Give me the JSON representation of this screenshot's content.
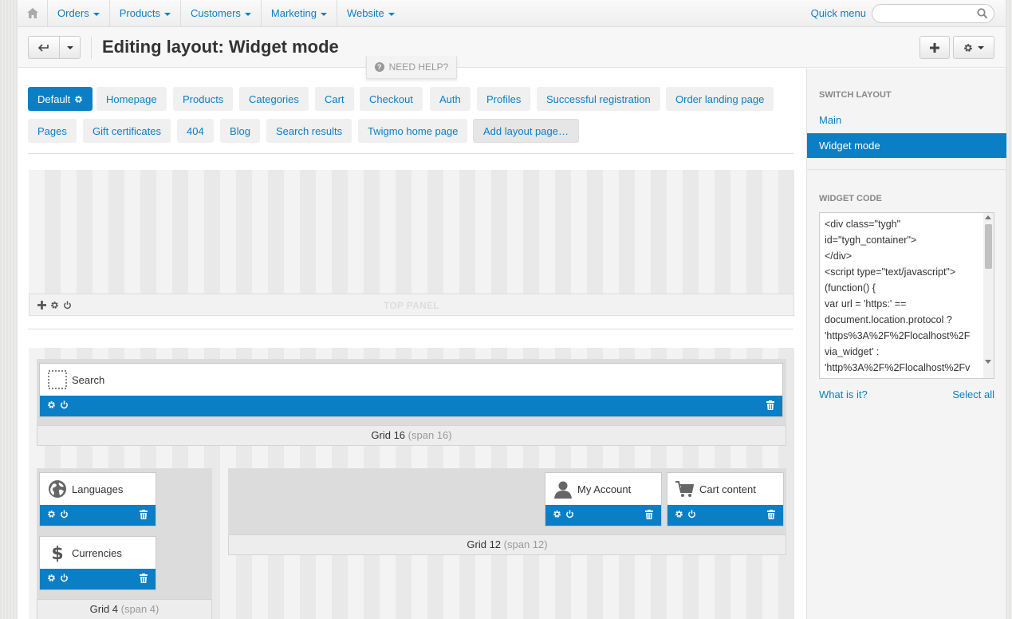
{
  "topnav": {
    "items": [
      {
        "label": "Orders"
      },
      {
        "label": "Products"
      },
      {
        "label": "Customers"
      },
      {
        "label": "Marketing"
      },
      {
        "label": "Website"
      }
    ],
    "quick_menu": "Quick menu",
    "search_placeholder": ""
  },
  "header": {
    "title": "Editing layout: Widget mode",
    "need_help": "NEED HELP?"
  },
  "tabs": [
    {
      "label": "Default"
    },
    {
      "label": "Homepage"
    },
    {
      "label": "Products"
    },
    {
      "label": "Categories"
    },
    {
      "label": "Cart"
    },
    {
      "label": "Checkout"
    },
    {
      "label": "Auth"
    },
    {
      "label": "Profiles"
    },
    {
      "label": "Successful registration"
    },
    {
      "label": "Order landing page"
    },
    {
      "label": "Pages"
    },
    {
      "label": "Gift certificates"
    },
    {
      "label": "404"
    },
    {
      "label": "Blog"
    },
    {
      "label": "Search results"
    },
    {
      "label": "Twigmo home page"
    },
    {
      "label": "Add layout page…"
    }
  ],
  "layout": {
    "top_panel_label": "TOP PANEL",
    "grids": [
      {
        "name": "Grid 16",
        "span": "(span 16)"
      },
      {
        "name": "Grid 4",
        "span": "(span 4)"
      },
      {
        "name": "Grid 12",
        "span": "(span 12)"
      }
    ],
    "blocks": [
      {
        "title": "Search",
        "icon": "dotted-square-icon"
      },
      {
        "title": "Languages",
        "icon": "globe-icon"
      },
      {
        "title": "Currencies",
        "icon": "dollar-icon"
      },
      {
        "title": "My Account",
        "icon": "user-icon"
      },
      {
        "title": "Cart content",
        "icon": "cart-icon"
      }
    ]
  },
  "sidebar": {
    "switch_layout_title": "SWITCH LAYOUT",
    "items": [
      {
        "label": "Main"
      },
      {
        "label": "Widget mode"
      }
    ],
    "widget_code_title": "WIDGET CODE",
    "widget_code": "<div class=\"tygh\"\nid=\"tygh_container\">\n</div>\n<script type=\"text/javascript\">\n(function() {\nvar url = 'https:' ==\ndocument.location.protocol ?\n'https%3A%2F%2Flocalhost%2F\nvia_widget' :\n'http%3A%2F%2Flocalhost%2Fv",
    "what_is_it": "What is it?",
    "select_all": "Select all"
  },
  "colors": {
    "accent": "#0b7fc5"
  }
}
